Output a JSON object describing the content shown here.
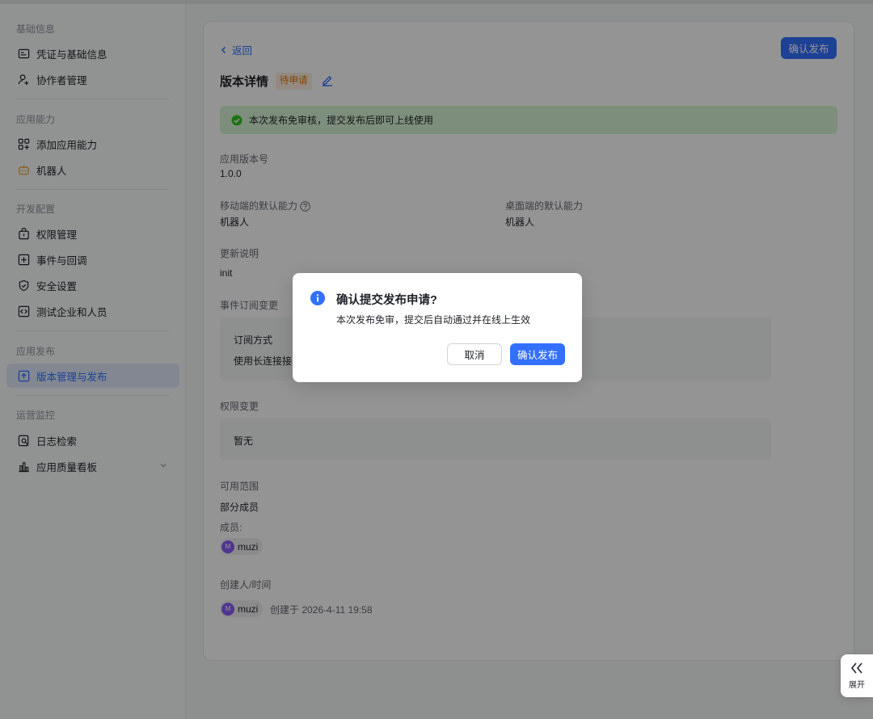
{
  "sidebar": {
    "sections": [
      {
        "title": "基础信息",
        "items": [
          {
            "label": "凭证与基础信息",
            "icon": "credential-icon"
          },
          {
            "label": "协作者管理",
            "icon": "collaborator-icon"
          }
        ]
      },
      {
        "title": "应用能力",
        "items": [
          {
            "label": "添加应用能力",
            "icon": "add-capability-icon"
          },
          {
            "label": "机器人",
            "icon": "robot-icon"
          }
        ]
      },
      {
        "title": "开发配置",
        "items": [
          {
            "label": "权限管理",
            "icon": "permission-icon"
          },
          {
            "label": "事件与回调",
            "icon": "event-icon"
          },
          {
            "label": "安全设置",
            "icon": "shield-icon"
          },
          {
            "label": "测试企业和人员",
            "icon": "code-icon"
          }
        ]
      },
      {
        "title": "应用发布",
        "items": [
          {
            "label": "版本管理与发布",
            "icon": "upload-icon",
            "active": true
          }
        ]
      },
      {
        "title": "运营监控",
        "items": [
          {
            "label": "日志检索",
            "icon": "log-search-icon"
          },
          {
            "label": "应用质量看板",
            "icon": "chart-icon"
          }
        ]
      }
    ]
  },
  "main": {
    "back_label": "返回",
    "confirm_button": "确认发布",
    "title": "版本详情",
    "status": "待申请",
    "notice": "本次发布免审核，提交发布后即可上线使用",
    "app_version_label": "应用版本号",
    "app_version_value": "1.0.0",
    "mobile_default_label": "移动端的默认能力",
    "mobile_default_value": "机器人",
    "desktop_default_label": "桌面端的默认能力",
    "desktop_default_value": "机器人",
    "update_notes_label": "更新说明",
    "update_notes_value": "init",
    "event_change_label": "事件订阅变更",
    "subscribe_method_label": "订阅方式",
    "subscribe_method_value": "使用长连接接",
    "permission_change_label": "权限变更",
    "permission_change_value": "暂无",
    "scope_label": "可用范围",
    "scope_value": "部分成员",
    "members_label": "成员:",
    "member_name": "muzi",
    "member_initial": "M",
    "creator_label": "创建人/时间",
    "creator_name": "muzi",
    "created_text": "创建于 2026-4-11 19:58"
  },
  "dialog": {
    "title": "确认提交发布申请?",
    "description": "本次发布免审，提交后自动通过并在线上生效",
    "cancel_label": "取消",
    "confirm_label": "确认发布"
  },
  "expand": {
    "label": "展开"
  },
  "colors": {
    "accent": "#3370ff",
    "success_bg": "#d9f5d6",
    "warning_text": "#de7802"
  }
}
